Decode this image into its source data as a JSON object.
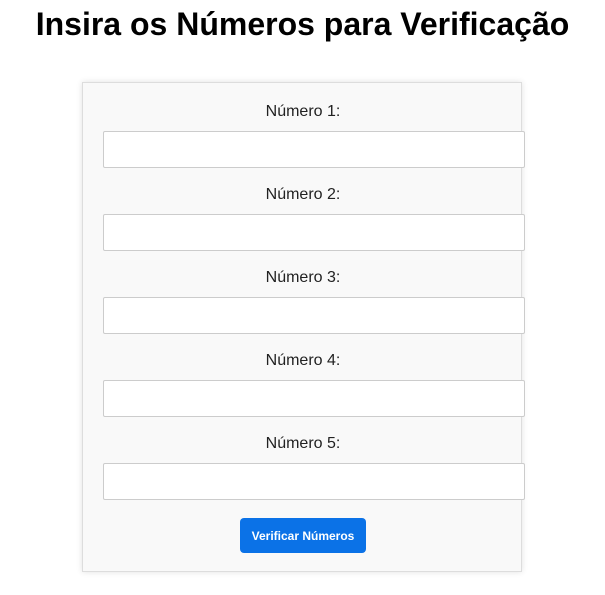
{
  "page": {
    "title": "Insira os Números para Verificação"
  },
  "form": {
    "fields": [
      {
        "label": "Número 1:",
        "value": "",
        "placeholder": ""
      },
      {
        "label": "Número 2:",
        "value": "",
        "placeholder": ""
      },
      {
        "label": "Número 3:",
        "value": "",
        "placeholder": ""
      },
      {
        "label": "Número 4:",
        "value": "",
        "placeholder": ""
      },
      {
        "label": "Número 5:",
        "value": "",
        "placeholder": ""
      }
    ],
    "submit_label": "Verificar Números"
  },
  "colors": {
    "accent": "#0b72e7",
    "card_background": "#f9f9f9",
    "input_border": "#cccccc"
  }
}
